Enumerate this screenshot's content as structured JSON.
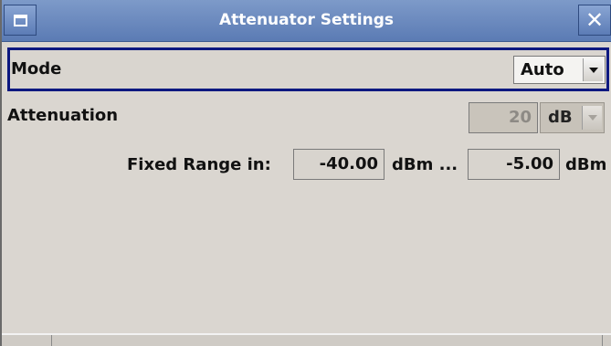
{
  "window": {
    "title": "Attenuator Settings",
    "close_glyph": "✕"
  },
  "mode": {
    "label": "Mode",
    "value": "Auto"
  },
  "attenuation": {
    "label": "Attenuation",
    "value": "20",
    "unit": "dB",
    "disabled": true
  },
  "fixed_range": {
    "label": "Fixed Range in:",
    "min_value": "-40.00",
    "min_unit": "dBm ...",
    "max_value": "-5.00",
    "max_unit": "dBm"
  },
  "icons": {
    "window_menu": "window-menu-icon",
    "close": "close-icon",
    "dropdown": "chevron-down-icon"
  },
  "colors": {
    "titlebar": "#6d8cc2",
    "focus_border": "#0d1880",
    "panel": "#dad6d0",
    "disabled_field": "#c9c4bb"
  }
}
